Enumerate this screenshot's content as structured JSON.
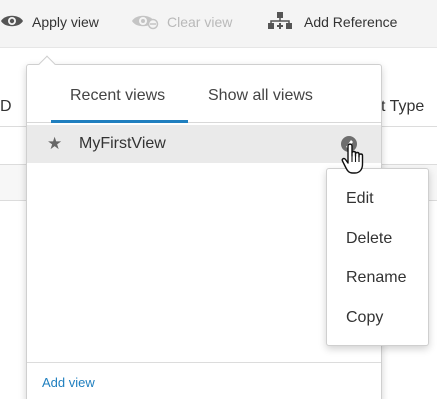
{
  "toolbar": {
    "apply_view": {
      "label": "Apply view",
      "icon": "eye-icon"
    },
    "clear_view": {
      "label": "Clear view",
      "icon": "eye-slash-icon",
      "disabled": true
    },
    "add_reference": {
      "label": "Add Reference",
      "icon": "network-plus-icon"
    }
  },
  "background_table": {
    "left_header": "D",
    "right_header": "t Type"
  },
  "views_popup": {
    "tabs": [
      {
        "label": "Recent views",
        "active": true
      },
      {
        "label": "Show all views",
        "active": false
      }
    ],
    "views": [
      {
        "name": "MyFirstView",
        "starred": true,
        "star_glyph": "★"
      }
    ],
    "add_view_label": "Add view"
  },
  "context_menu": {
    "items": [
      {
        "label": "Edit"
      },
      {
        "label": "Delete"
      },
      {
        "label": "Rename"
      },
      {
        "label": "Copy"
      }
    ]
  },
  "colors": {
    "accent": "#1f7fbf",
    "toolbar_bg": "#f4f4f4",
    "selected_row_bg": "#eaeaea",
    "disabled_text": "#b9b9b9"
  }
}
